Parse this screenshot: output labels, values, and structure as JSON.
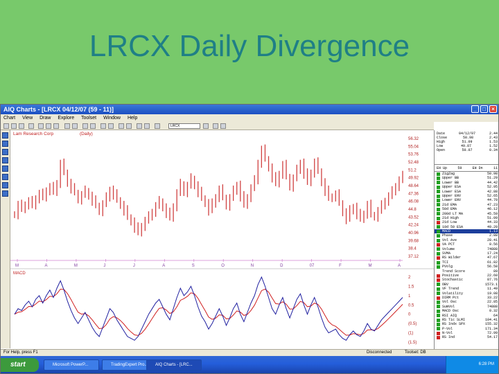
{
  "slide_title": "LRCX Daily Divergence",
  "window": {
    "title": "AIQ Charts - [LRCX 04/12/07 (59 - 11)]",
    "menu": [
      "Chart",
      "View",
      "Draw",
      "Explore",
      "Toolset",
      "Window",
      "Help"
    ],
    "ticker_value": "LRCX"
  },
  "chart": {
    "company": "Lam Research Corp",
    "period": "(Daily)",
    "price_ticks": [
      "56.32",
      "55.04",
      "53.76",
      "52.48",
      "51.2",
      "49.92",
      "48.64",
      "47.36",
      "46.08",
      "44.8",
      "43.52",
      "42.24",
      "40.96",
      "39.68",
      "38.4",
      "37.12"
    ],
    "month_labels": [
      "M",
      "A",
      "M",
      "J",
      "J",
      "A",
      "S",
      "O",
      "N",
      "D",
      "07",
      "F",
      "M",
      "A"
    ],
    "macd_label": "MACD",
    "macd_ticks": [
      "2",
      "1.5",
      "1",
      "0.5",
      "0",
      "(0.5)",
      "(1)",
      "(1.5)"
    ]
  },
  "chart_data": {
    "type": "line",
    "series": [
      {
        "name": "LRCX",
        "values": [
          44.0,
          45.5,
          44.8,
          45.6,
          46.1,
          45.4,
          46.6,
          47.3,
          46.7,
          47.9,
          48.4,
          47.6,
          49.1,
          52.2,
          50.8,
          49.1,
          48.2,
          47.5,
          46.4,
          47.1,
          47.8,
          47.0,
          46.2,
          45.4,
          44.5,
          45.6,
          46.7,
          48.0,
          47.2,
          46.3,
          45.5,
          44.6,
          43.5,
          42.8,
          41.8,
          41.0,
          42.1,
          42.9,
          43.6,
          44.4,
          45.3,
          46.1,
          45.1,
          44.2,
          43.4,
          45.3,
          47.4,
          48.9,
          47.6,
          48.6,
          49.8,
          48.7,
          47.6,
          46.6,
          45.8,
          44.6,
          45.7,
          46.8,
          48.0,
          46.7,
          45.4,
          46.6,
          47.8,
          48.8,
          46.9,
          45.5,
          46.8,
          48.2,
          49.5,
          52.4,
          54.5,
          53.0,
          51.6,
          50.0,
          49.0,
          50.6,
          52.0,
          50.1,
          48.5,
          49.8,
          51.2,
          52.4,
          50.6,
          49.2,
          50.8,
          52.4,
          51.0,
          49.2,
          47.8,
          46.6,
          46.9,
          47.2,
          45.8,
          44.3,
          43.2,
          44.6,
          45.2,
          44.0,
          43.2,
          44.1,
          45.5,
          43.9,
          43.6,
          44.5,
          45.4,
          46.2,
          46.9,
          47.7,
          48.6,
          49.5,
          50.2
        ]
      },
      {
        "name": "MACD",
        "values": [
          0.0,
          0.3,
          0.2,
          0.5,
          0.7,
          0.4,
          0.8,
          1.0,
          0.6,
          1.0,
          1.3,
          0.9,
          1.4,
          1.8,
          1.3,
          0.7,
          0.2,
          -0.2,
          -0.5,
          -0.2,
          0.1,
          -0.3,
          -0.7,
          -1.0,
          -1.2,
          -0.7,
          -0.2,
          0.3,
          0.1,
          -0.3,
          -0.6,
          -0.9,
          -1.2,
          -1.3,
          -1.4,
          -1.2,
          -0.8,
          -0.4,
          0.0,
          0.3,
          0.6,
          0.8,
          0.4,
          0.0,
          -0.3,
          0.3,
          0.9,
          1.4,
          1.0,
          1.2,
          1.5,
          1.0,
          0.4,
          -0.1,
          -0.4,
          -0.8,
          -0.5,
          -0.1,
          0.3,
          -0.1,
          -0.6,
          -0.2,
          0.3,
          0.6,
          0.0,
          -0.4,
          0.1,
          0.6,
          1.0,
          1.6,
          2.0,
          1.5,
          0.9,
          0.3,
          0.0,
          0.5,
          0.9,
          0.3,
          -0.2,
          0.3,
          0.8,
          1.1,
          0.5,
          0.0,
          0.5,
          0.9,
          0.4,
          -0.2,
          -0.7,
          -1.0,
          -0.9,
          -0.8,
          -1.1,
          -1.3,
          -1.4,
          -1.1,
          -0.9,
          -1.1,
          -1.2,
          -0.9,
          -0.5,
          -0.8,
          -0.9,
          -0.6,
          -0.3,
          -0.1,
          0.1,
          0.3,
          0.5,
          0.7,
          0.9
        ]
      }
    ],
    "ylim": [
      37.12,
      56.32
    ],
    "macd_ylim": [
      -1.5,
      2
    ]
  },
  "side_panel": {
    "summary": [
      [
        "Date",
        "04/12/07"
      ],
      [
        "Close",
        "50.98"
      ],
      [
        "High",
        "51.09"
      ],
      [
        "Low",
        "49.87"
      ],
      [
        "Open",
        "50.07"
      ]
    ],
    "summary_extra": [
      "2.44",
      "2.43",
      "1.53",
      "1.52",
      "0.34"
    ],
    "eh_up": "EH Up",
    "eh_val": "59",
    "eh_dn": "EH Dn",
    "eh_dn_val": "11",
    "indicators": [
      {
        "label": "ZigZag",
        "value": "50.98",
        "mark": "green"
      },
      {
        "label": "Upper BB",
        "value": "51.29",
        "mark": "green"
      },
      {
        "label": "Lower BB",
        "value": "44.42",
        "mark": "green"
      },
      {
        "label": "Upper ESA",
        "value": "52.95",
        "mark": "green"
      },
      {
        "label": "Lower ESA",
        "value": "42.88",
        "mark": "green"
      },
      {
        "label": "Upper ENV",
        "value": "52.65",
        "mark": "green"
      },
      {
        "label": "Lower ENV",
        "value": "44.70",
        "mark": "green"
      },
      {
        "label": "21d EMA",
        "value": "47.23",
        "mark": "green"
      },
      {
        "label": "50d EMA",
        "value": "46.12",
        "mark": "green"
      },
      {
        "label": "200d LT MA",
        "value": "45.59",
        "mark": "green"
      },
      {
        "label": "21d High",
        "value": "51.09",
        "mark": "green"
      },
      {
        "label": "21d Low",
        "value": "44.33",
        "mark": "red"
      },
      {
        "label": "10d 50 ESA",
        "value": "49.20",
        "mark": "green"
      },
      {
        "label": "MACD",
        "value": "1.13",
        "mark": "green",
        "selected": true
      },
      {
        "label": "Phase",
        "value": "2.88",
        "mark": "green"
      },
      {
        "label": "Vol Ave",
        "value": "28.41",
        "mark": "green"
      },
      {
        "label": "VA PCT",
        "value": "8.56",
        "mark": "red"
      },
      {
        "label": "Volume",
        "value": "74888",
        "mark": "green"
      },
      {
        "label": "SVMA",
        "value": "17.24",
        "mark": "green"
      },
      {
        "label": "RS Wilder",
        "value": "47.67",
        "mark": "red"
      },
      {
        "label": "TCI",
        "value": "61.82",
        "mark": "green"
      },
      {
        "label": "PVolg",
        "value": "56.58",
        "mark": "green"
      },
      {
        "label": "Trend Score",
        "value": "89",
        "mark": "none"
      },
      {
        "label": "Positive",
        "value": "22.60",
        "mark": "red"
      },
      {
        "label": "Stochastic",
        "value": "87.76",
        "mark": "red"
      },
      {
        "label": "OBV",
        "value": "1573.1",
        "mark": "green"
      },
      {
        "label": "VF Trend",
        "value": "11.49",
        "mark": "green"
      },
      {
        "label": "Volatility",
        "value": "19.08",
        "mark": "green"
      },
      {
        "label": "DIRM Pct",
        "value": "33.22",
        "mark": "red"
      },
      {
        "label": "Vol Osc",
        "value": "22.85",
        "mark": "green"
      },
      {
        "label": "SumVol",
        "value": "74888",
        "mark": "green"
      },
      {
        "label": "MACD Osc",
        "value": "0.32",
        "mark": "green"
      },
      {
        "label": "RSI AIQ",
        "value": "64",
        "mark": "green"
      },
      {
        "label": "RS Tic SLMI",
        "value": "104.41",
        "mark": "green"
      },
      {
        "label": "RS Indx SPX",
        "value": "155.32",
        "mark": "green"
      },
      {
        "label": "P-Vol",
        "value": "171.34",
        "mark": "green"
      },
      {
        "label": "N-Vol",
        "value": "72.99",
        "mark": "red"
      },
      {
        "label": "RS Ind",
        "value": "54.17",
        "mark": "red"
      }
    ]
  },
  "status": {
    "help_text": "For Help, press F1",
    "connection": "Disconnected",
    "toolset": "Toolset: DB"
  },
  "taskbar": {
    "start_label": "start",
    "tasks": [
      "Microsoft PowerP...",
      "TradingExpert Pro...",
      "AIQ Charts - [LRC..."
    ],
    "clock": "6:28 PM"
  },
  "colors": {
    "up_bar": "#d04040",
    "macd_line": "#2020a0",
    "signal_line": "#d02020",
    "grid_line": "#c060c0"
  }
}
